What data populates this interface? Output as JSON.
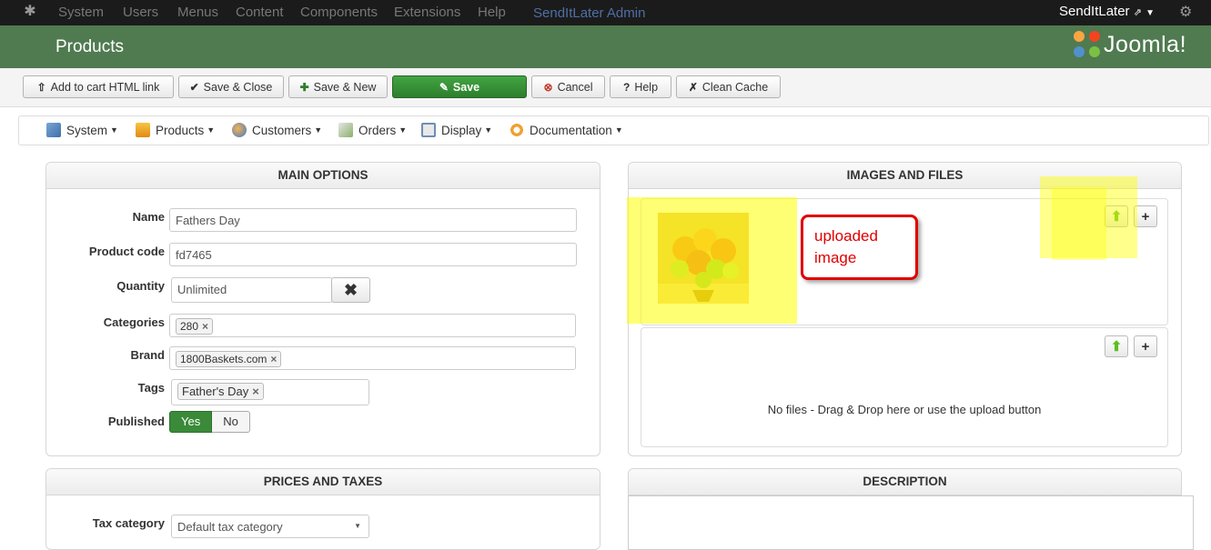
{
  "topbar": {
    "menu": [
      "System",
      "Users",
      "Menus",
      "Content",
      "Components",
      "Extensions",
      "Help"
    ],
    "site_name": "SendItLater Admin",
    "user": "SendItLater"
  },
  "header": {
    "title": "Products",
    "brand": "Joomla!"
  },
  "toolbar": {
    "buttons": [
      {
        "label": "Add to cart HTML link",
        "icon": "upload-icon"
      },
      {
        "label": "Save & Close",
        "icon": "check-icon"
      },
      {
        "label": "Save & New",
        "icon": "plus-icon"
      },
      {
        "label": "Save",
        "icon": "edit-icon"
      },
      {
        "label": "Cancel",
        "icon": "cancel-icon"
      },
      {
        "label": "Help",
        "icon": "help-icon"
      },
      {
        "label": "Clean Cache",
        "icon": "broom-icon"
      }
    ]
  },
  "submenu": {
    "items": [
      "System",
      "Products",
      "Customers",
      "Orders",
      "Display",
      "Documentation"
    ]
  },
  "main_options": {
    "title": "MAIN OPTIONS",
    "name_label": "Name",
    "name_value": "Fathers Day",
    "code_label": "Product code",
    "code_value": "fd7465",
    "quantity_label": "Quantity",
    "quantity_value": "Unlimited",
    "categories_label": "Categories",
    "categories_chip": "280",
    "brand_label": "Brand",
    "brand_chip": "1800Baskets.com",
    "tags_label": "Tags",
    "tags_chip": "Father's Day",
    "published_label": "Published",
    "published_yes": "Yes",
    "published_no": "No"
  },
  "images": {
    "title": "IMAGES AND FILES",
    "annotation": "uploaded image",
    "no_files": "No files - Drag & Drop here or use the upload button"
  },
  "prices": {
    "title": "PRICES AND TAXES",
    "tax_label": "Tax category",
    "tax_value": "Default tax category"
  },
  "description": {
    "title": "DESCRIPTION"
  },
  "colors": {
    "header_green": "#507a50",
    "save_green": "#3a8a3a",
    "annotation_red": "#e00000",
    "highlight": "#ffff00"
  }
}
